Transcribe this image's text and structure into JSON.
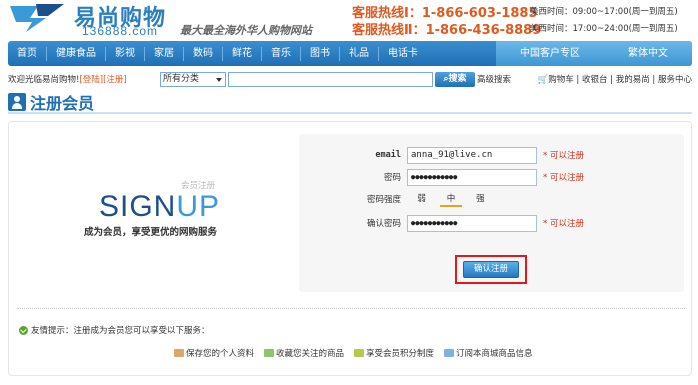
{
  "header": {
    "logo_cn": "易尚购物",
    "logo_url": "136888.com",
    "slogan": "最大最全海外华人购物网站",
    "hotline1": "客服热线Ⅰ：1-866-603-1885",
    "hotline2": "客服热线Ⅱ：1-866-436-8889",
    "hours1": "美西时间：09:00~17:00(周一到周五)",
    "hours2": "美西时间：17:00~24:00(周一到周五)"
  },
  "nav": {
    "items": [
      "首页",
      "健康食品",
      "影视",
      "家居",
      "数码",
      "鲜花",
      "音乐",
      "图书",
      "礼品",
      "电话卡"
    ],
    "right_items": [
      "中国客户专区",
      "繁体中文"
    ]
  },
  "subbar": {
    "welcome": "欢迎光临易尚购物!",
    "login": "[登陆]",
    "register": "[注册]",
    "category_selected": "所有分类",
    "search_button": "搜索",
    "advanced": "高级搜索",
    "toplinks": "购物车 | 收银台 | 我的易尚 | 服务中心"
  },
  "page": {
    "title": "注册会员"
  },
  "signup": {
    "small_label": "会员注册",
    "big_sign": "SIGN",
    "big_up": "UP",
    "subtitle": "成为会员，享受更优的网购服务"
  },
  "form": {
    "email_label": "email",
    "email_value": "anna_91@live.cn",
    "email_status": "* 可以注册",
    "password_label": "密码",
    "password_value": "●●●●●●●●●●●",
    "password_status": "* 可以注册",
    "strength_label": "密码强度",
    "strength_levels": [
      "弱",
      "中",
      "强"
    ],
    "confirm_label": "确认密码",
    "confirm_value": "●●●●●●●●●●●",
    "confirm_status": "* 可以注册",
    "submit_label": "确认注册"
  },
  "tips": {
    "text": "友情提示：注册成为会员您可以享受以下服务：",
    "benefits": [
      "保存您的个人资料",
      "收藏您关注的商品",
      "享受会员积分制度",
      "订阅本商城商品信息"
    ]
  },
  "colors": {
    "brand_blue": "#1f6fb4",
    "accent_orange": "#e05a1f",
    "status_red": "#d2301e",
    "highlight_red": "#e0191d"
  }
}
